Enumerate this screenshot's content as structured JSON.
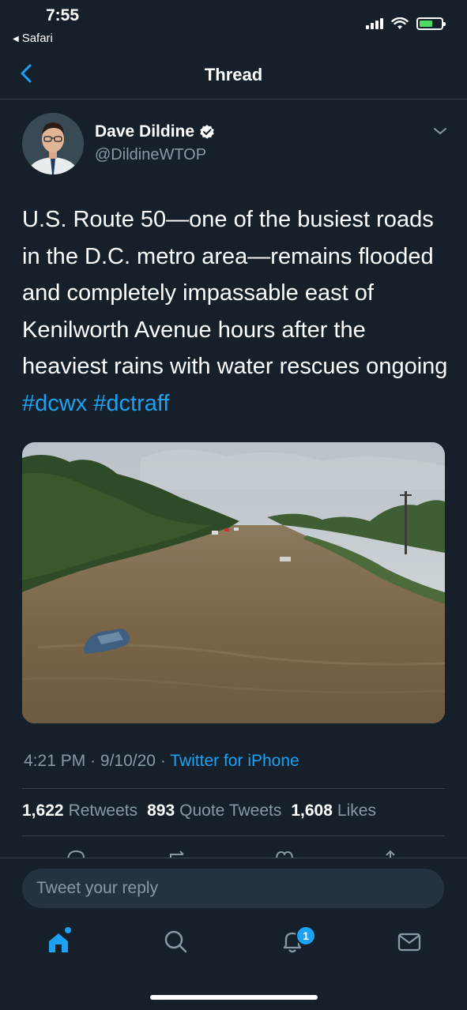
{
  "status_bar": {
    "time": "7:55",
    "back_app": "Safari",
    "icons": [
      "signal-icon",
      "wifi-icon",
      "battery-charging-icon"
    ]
  },
  "header": {
    "title": "Thread"
  },
  "author": {
    "name": "Dave Dildine",
    "handle": "@DildineWTOP",
    "verified": true
  },
  "tweet": {
    "text": "U.S. Route 50—one of the busiest roads in the D.C. metro area—remains flooded and completely impassable east of Kenilworth Avenue hours after the heaviest rains with water rescues ongoing ",
    "hashtags": [
      "#dcwx",
      "#dctraff"
    ],
    "time": "4:21 PM",
    "date": "9/10/20",
    "separator": "·",
    "source": "Twitter for iPhone"
  },
  "stats": {
    "retweets_count": "1,622",
    "retweets_label": "Retweets",
    "quote_count": "893",
    "quote_label": "Quote Tweets",
    "likes_count": "1,608",
    "likes_label": "Likes"
  },
  "reply": {
    "placeholder": "Tweet your reply"
  },
  "tab_bar": {
    "items": [
      "home-icon",
      "search-icon",
      "notifications-icon",
      "messages-icon"
    ],
    "notification_badge": "1"
  },
  "colors": {
    "background": "#15202b",
    "accent": "#1da1f2",
    "secondary_text": "#8899a6",
    "divider": "#38444d"
  }
}
